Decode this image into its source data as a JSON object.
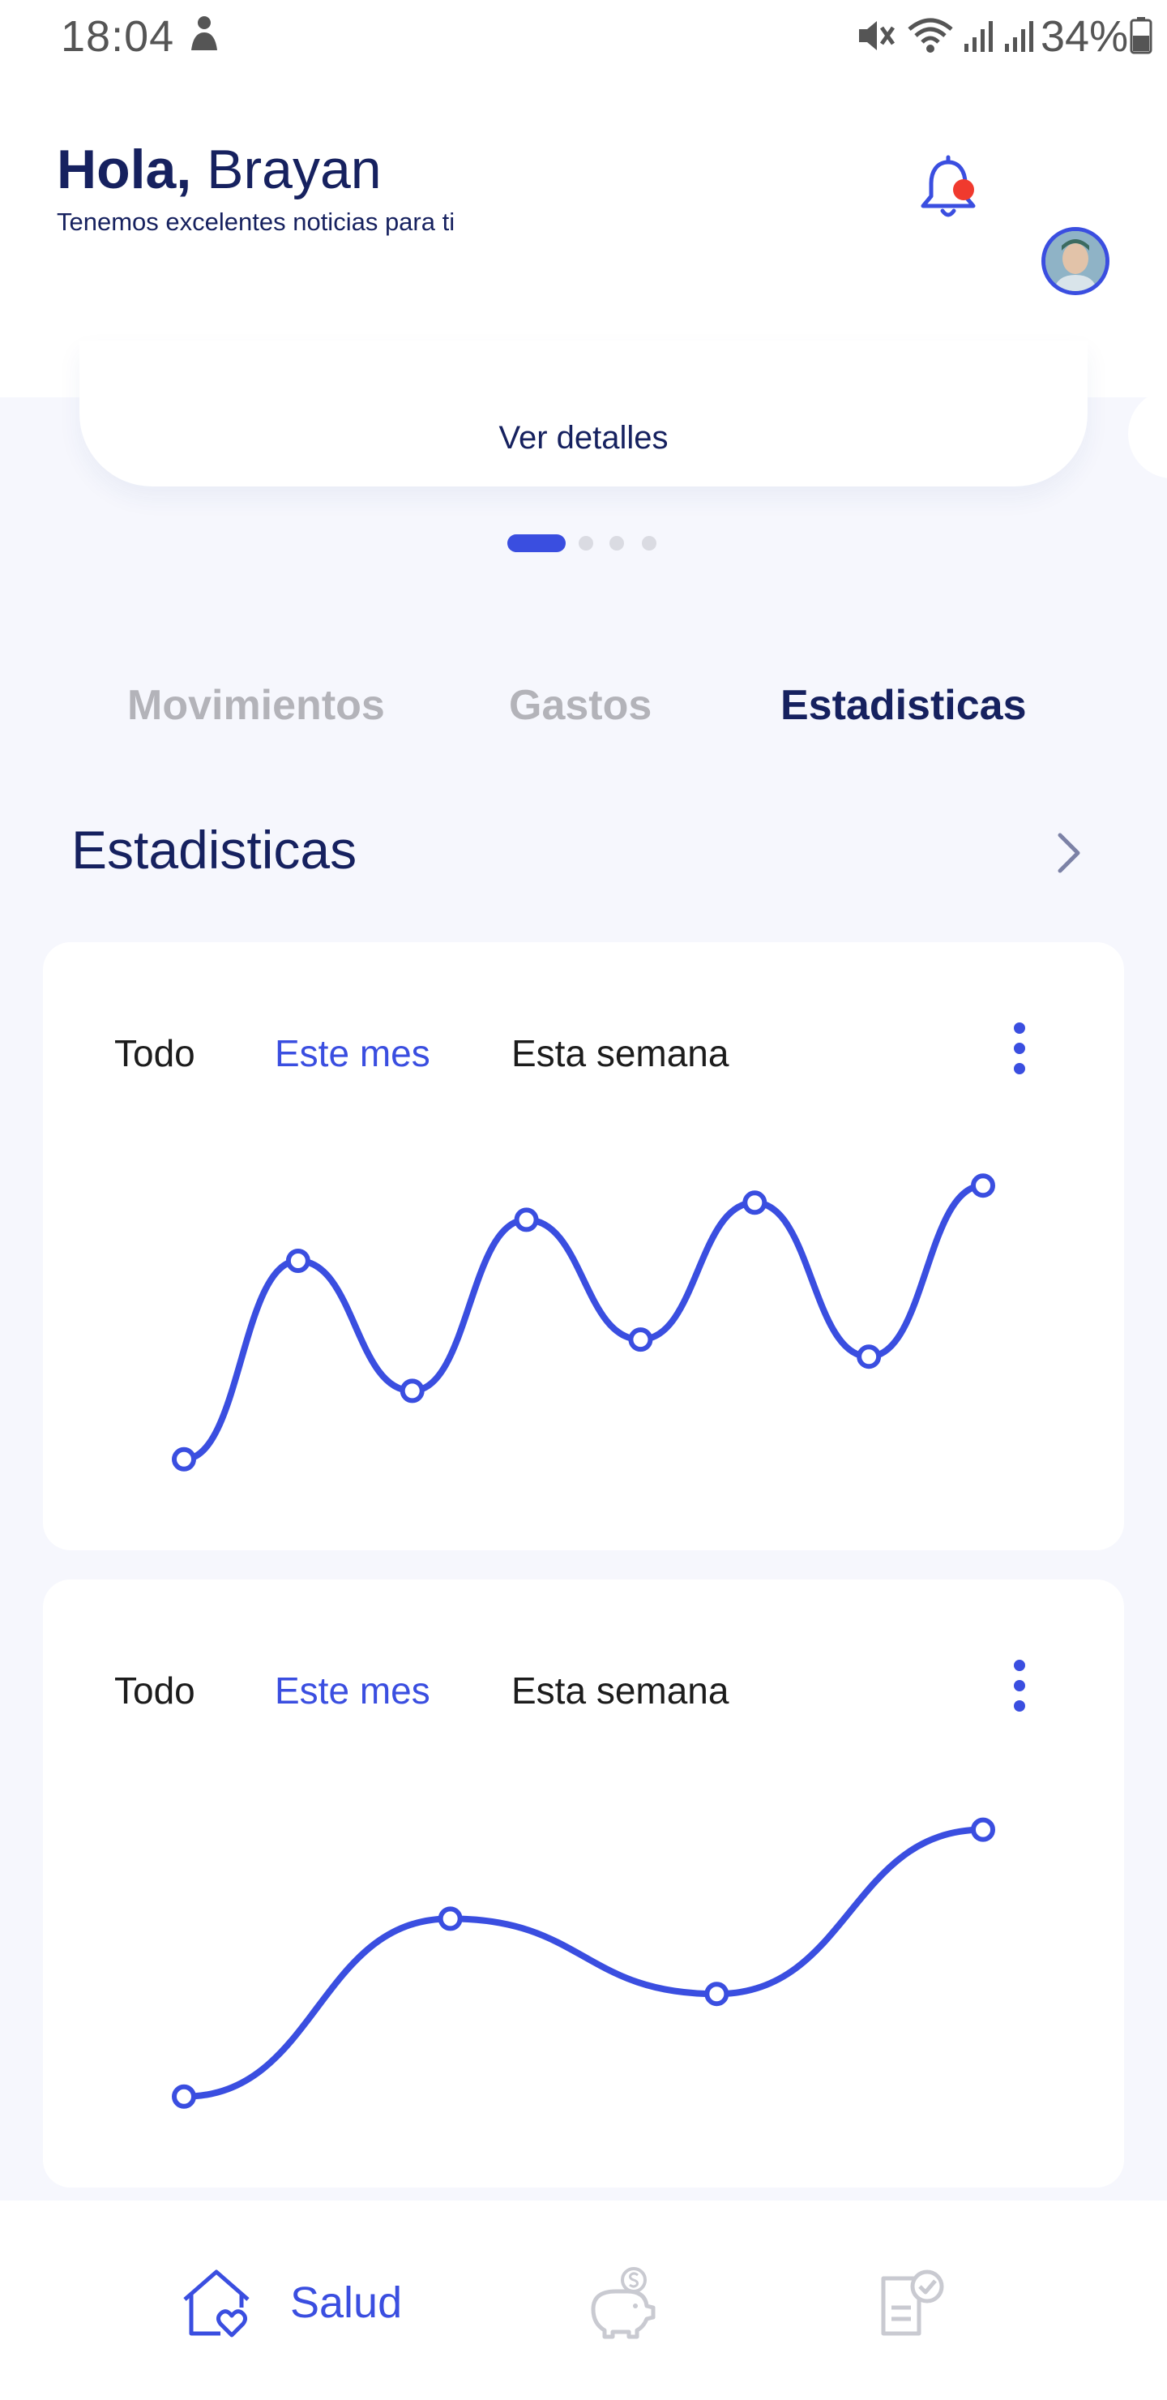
{
  "status_bar": {
    "time": "18:04",
    "battery": "34%"
  },
  "header": {
    "greeting_hello": "Hola,",
    "greeting_name": "Brayan",
    "subtitle": "Tenemos excelentes noticias para ti",
    "notification_dot_color": "#f03a2e"
  },
  "carousel": {
    "link_label": "Ver detalles",
    "page_count": 4,
    "active_page": 1
  },
  "tabs": [
    {
      "label": "Movimientos",
      "active": false
    },
    {
      "label": "Gastos",
      "active": false
    },
    {
      "label": "Estadisticas",
      "active": true
    }
  ],
  "section": {
    "title": "Estadisticas"
  },
  "cards": [
    {
      "filters": [
        {
          "label": "Todo",
          "selected": false
        },
        {
          "label": "Este mes",
          "selected": true
        },
        {
          "label": "Esta semana",
          "selected": false
        }
      ],
      "chart_data": {
        "type": "line",
        "series": [
          {
            "values": [
              10,
              68,
              30,
              80,
              45,
              85,
              40,
              90
            ]
          }
        ],
        "ylim": [
          0,
          100
        ],
        "grid": false
      }
    },
    {
      "filters": [
        {
          "label": "Todo",
          "selected": false
        },
        {
          "label": "Este mes",
          "selected": true
        },
        {
          "label": "Esta semana",
          "selected": false
        }
      ],
      "chart_data": {
        "type": "line",
        "series": [
          {
            "values": [
              10,
              62,
              40,
              88
            ]
          }
        ],
        "ylim": [
          0,
          100
        ],
        "grid": false
      }
    }
  ],
  "bottom_nav": {
    "items": [
      {
        "icon": "home-heart-icon",
        "label": "Salud",
        "active": true
      },
      {
        "icon": "piggy-bank-icon",
        "active": false
      },
      {
        "icon": "checklist-icon",
        "active": false
      }
    ]
  },
  "colors": {
    "accent": "#3a4ee0",
    "navy": "#16215f",
    "inactive": "#b3b3b9",
    "background": "#f6f7fd"
  }
}
